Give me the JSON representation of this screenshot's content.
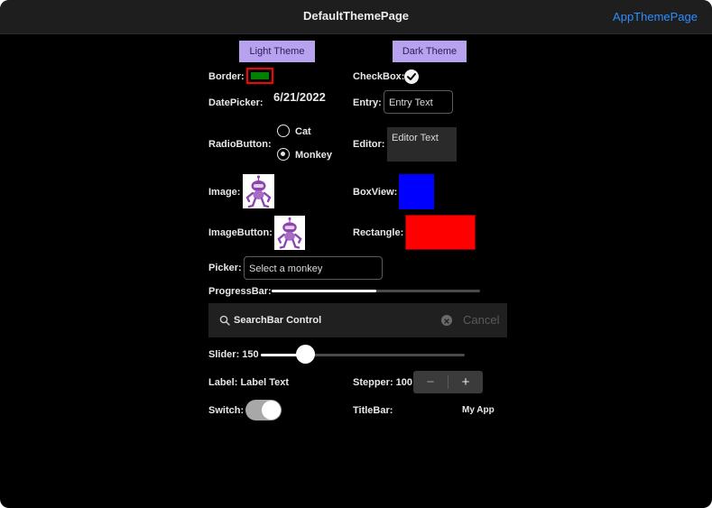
{
  "window": {
    "title": "DefaultThemePage",
    "nav_link": "AppThemePage"
  },
  "theme_buttons": {
    "light": "Light Theme",
    "dark": "Dark Theme"
  },
  "labels": {
    "border": "Border:",
    "checkbox": "CheckBox:",
    "datepicker": "DatePicker:",
    "entry": "Entry:",
    "radiobutton": "RadioButton:",
    "editor": "Editor:",
    "image": "Image:",
    "boxview": "BoxView:",
    "imagebutton": "ImageButton:",
    "rectangle": "Rectangle:",
    "picker": "Picker:",
    "progressbar": "ProgressBar:",
    "slider": "Slider: 150",
    "label": "Label: Label Text",
    "stepper": "Stepper: 100",
    "switch": "Switch:",
    "titlebar": "TitleBar:"
  },
  "datepicker": {
    "value": "6/21/2022"
  },
  "entry": {
    "value": "Entry Text"
  },
  "radio": {
    "options": [
      "Cat",
      "Monkey"
    ],
    "selected": "Monkey"
  },
  "editor": {
    "value": "Editor Text"
  },
  "picker": {
    "placeholder": "Select a monkey"
  },
  "progress": {
    "value": 0.5
  },
  "searchbar": {
    "placeholder": "SearchBar Control",
    "cancel": "Cancel"
  },
  "slider": {
    "value": 150
  },
  "stepper": {
    "minus": "−",
    "plus": "+"
  },
  "switch": {
    "on": true
  },
  "titlebar": {
    "text": "My App"
  },
  "colors": {
    "theme_button": "#b7a2f0",
    "border_fill": "#008000",
    "border_stroke": "#ff0000",
    "boxview": "#0000ff",
    "rectangle": "#ff0000",
    "link": "#2f8cff",
    "bot": "#8e44ad"
  }
}
